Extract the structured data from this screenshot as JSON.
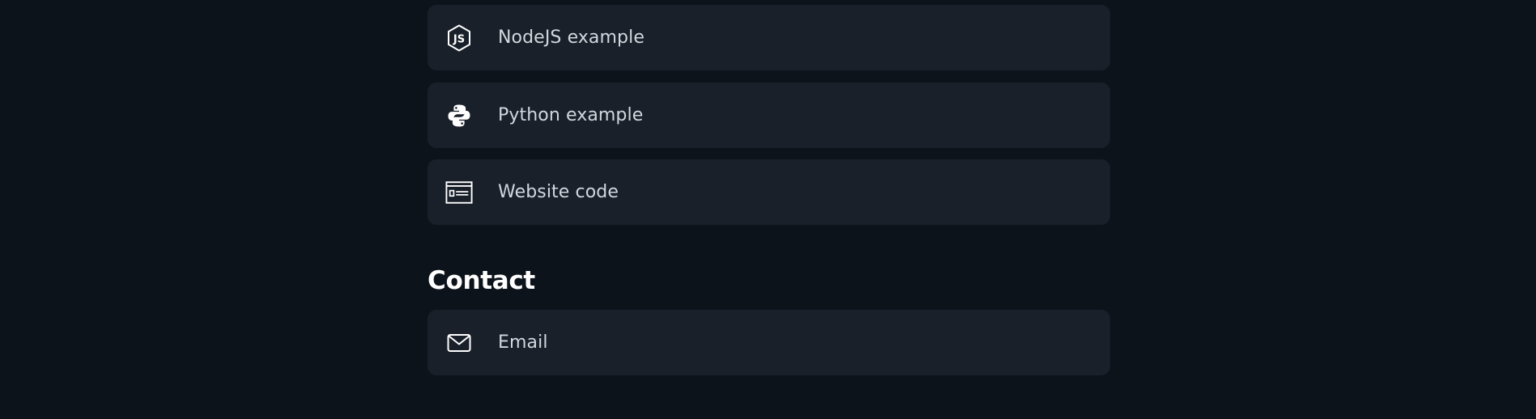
{
  "links": [
    {
      "label": "NodeJS example",
      "icon": "nodejs-icon"
    },
    {
      "label": "Python example",
      "icon": "python-icon"
    },
    {
      "label": "Website code",
      "icon": "website-code-icon"
    }
  ],
  "contact": {
    "heading": "Contact",
    "items": [
      {
        "label": "Email",
        "icon": "mail-icon"
      }
    ]
  },
  "colors": {
    "background": "#0d131b",
    "card": "#19202a",
    "text": "#d3d7dd",
    "heading": "#ffffff"
  }
}
